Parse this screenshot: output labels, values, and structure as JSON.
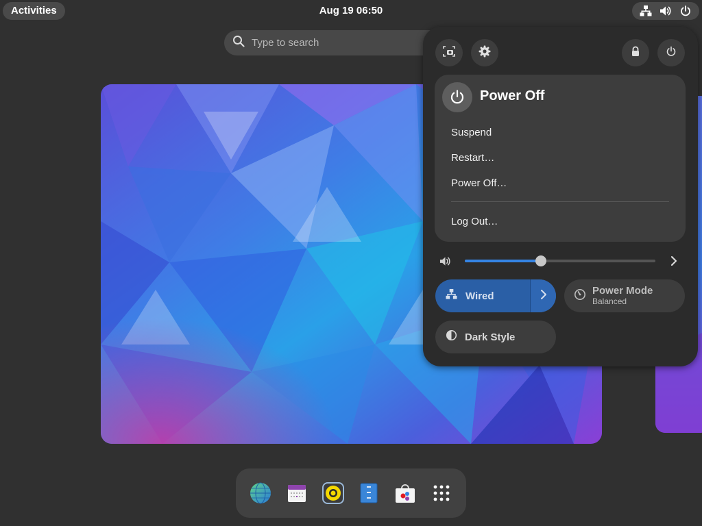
{
  "topbar": {
    "activities_label": "Activities",
    "clock": "Aug 19  06:50",
    "indicators": [
      "network-wired-icon",
      "volume-icon",
      "power-icon"
    ]
  },
  "search": {
    "placeholder": "Type to search"
  },
  "dash": {
    "apps": [
      "web-browser-icon",
      "calendar-icon",
      "rhythmbox-icon",
      "file-manager-icon",
      "software-store-icon",
      "app-grid-icon"
    ]
  },
  "quick_settings": {
    "top_buttons": [
      "screenshot-icon",
      "settings-icon",
      "lock-icon",
      "power-icon"
    ],
    "power_menu": {
      "title": "Power Off",
      "items": [
        "Suspend",
        "Restart…",
        "Power Off…",
        "Log Out…"
      ]
    },
    "volume": {
      "level": 0.4
    },
    "wired": {
      "label": "Wired",
      "active": true
    },
    "power_mode": {
      "title": "Power Mode",
      "subtitle": "Balanced"
    },
    "dark_style": {
      "label": "Dark Style"
    }
  },
  "colors": {
    "accent": "#3584e4",
    "active_toggle": "#2a5fa6",
    "panel": "#2b2b2b",
    "background": "#303030"
  }
}
